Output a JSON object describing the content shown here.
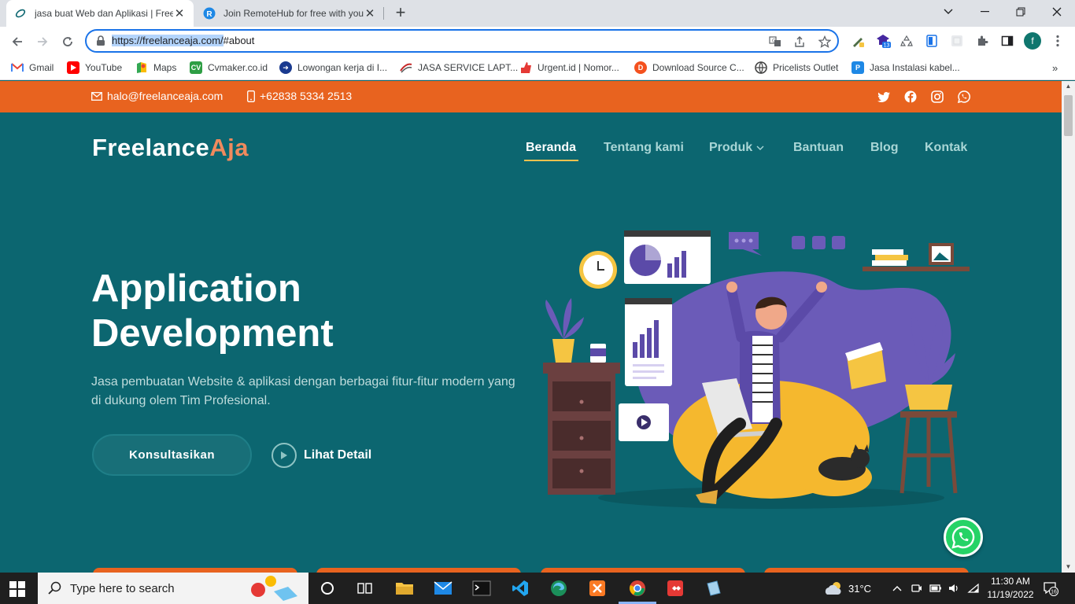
{
  "browser": {
    "tabs": [
      {
        "title": "jasa buat Web dan Aplikasi | Free",
        "active": true
      },
      {
        "title": "Join RemoteHub for free with you",
        "active": false
      }
    ],
    "url_selected": "https://freelanceaja.com/",
    "url_rest": "#about",
    "profile_letter": "f",
    "extension_badge": "13",
    "bookmarks": [
      {
        "label": "Gmail",
        "icon": "gmail-icon",
        "color": "#ea4335"
      },
      {
        "label": "YouTube",
        "icon": "youtube-icon",
        "color": "#ff0000"
      },
      {
        "label": "Maps",
        "icon": "maps-icon",
        "color": "#34a853"
      },
      {
        "label": "Cvmaker.co.id",
        "icon": "cvmaker-icon",
        "color": "#2e9e44"
      },
      {
        "label": "Lowongan kerja di I...",
        "icon": "lowongan-icon",
        "color": "#1a3a8f"
      },
      {
        "label": "JASA SERVICE LAPT...",
        "icon": "service-icon",
        "color": "#c62828"
      },
      {
        "label": "Urgent.id | Nomor...",
        "icon": "urgent-icon",
        "color": "#e53935"
      },
      {
        "label": "Download Source C...",
        "icon": "download-icon",
        "color": "#f4511e"
      },
      {
        "label": "Pricelists Outlet",
        "icon": "pricelists-icon",
        "color": "#424242"
      },
      {
        "label": "Jasa Instalasi kabel...",
        "icon": "instalasi-icon",
        "color": "#1e88e5"
      }
    ]
  },
  "page": {
    "email": "halo@freelanceaja.com",
    "phone": "+62838 5334 2513",
    "logo_main": "Freelance",
    "logo_accent": "Aja",
    "nav": [
      {
        "label": "Beranda",
        "active": true
      },
      {
        "label": "Tentang kami",
        "active": false
      },
      {
        "label": "Produk",
        "active": false
      },
      {
        "label": "Bantuan",
        "active": false
      },
      {
        "label": "Blog",
        "active": false
      },
      {
        "label": "Kontak",
        "active": false
      }
    ],
    "hero_title_line1": "Application",
    "hero_title_line2": "Development",
    "hero_desc": "Jasa pembuatan Website & aplikasi dengan berbagai fitur-fitur modern yang di dukung olem Tim Profesional.",
    "cta_primary": "Konsultasikan",
    "cta_secondary": "Lihat Detail",
    "colors": {
      "teal": "#0c6670",
      "orange": "#e8631f",
      "accent": "#f08a5d",
      "underline": "#f2c14e"
    }
  },
  "taskbar": {
    "search_placeholder": "Type here to search",
    "weather": "31°C",
    "time": "11:30 AM",
    "date": "11/19/2022",
    "notification_count": "16"
  }
}
